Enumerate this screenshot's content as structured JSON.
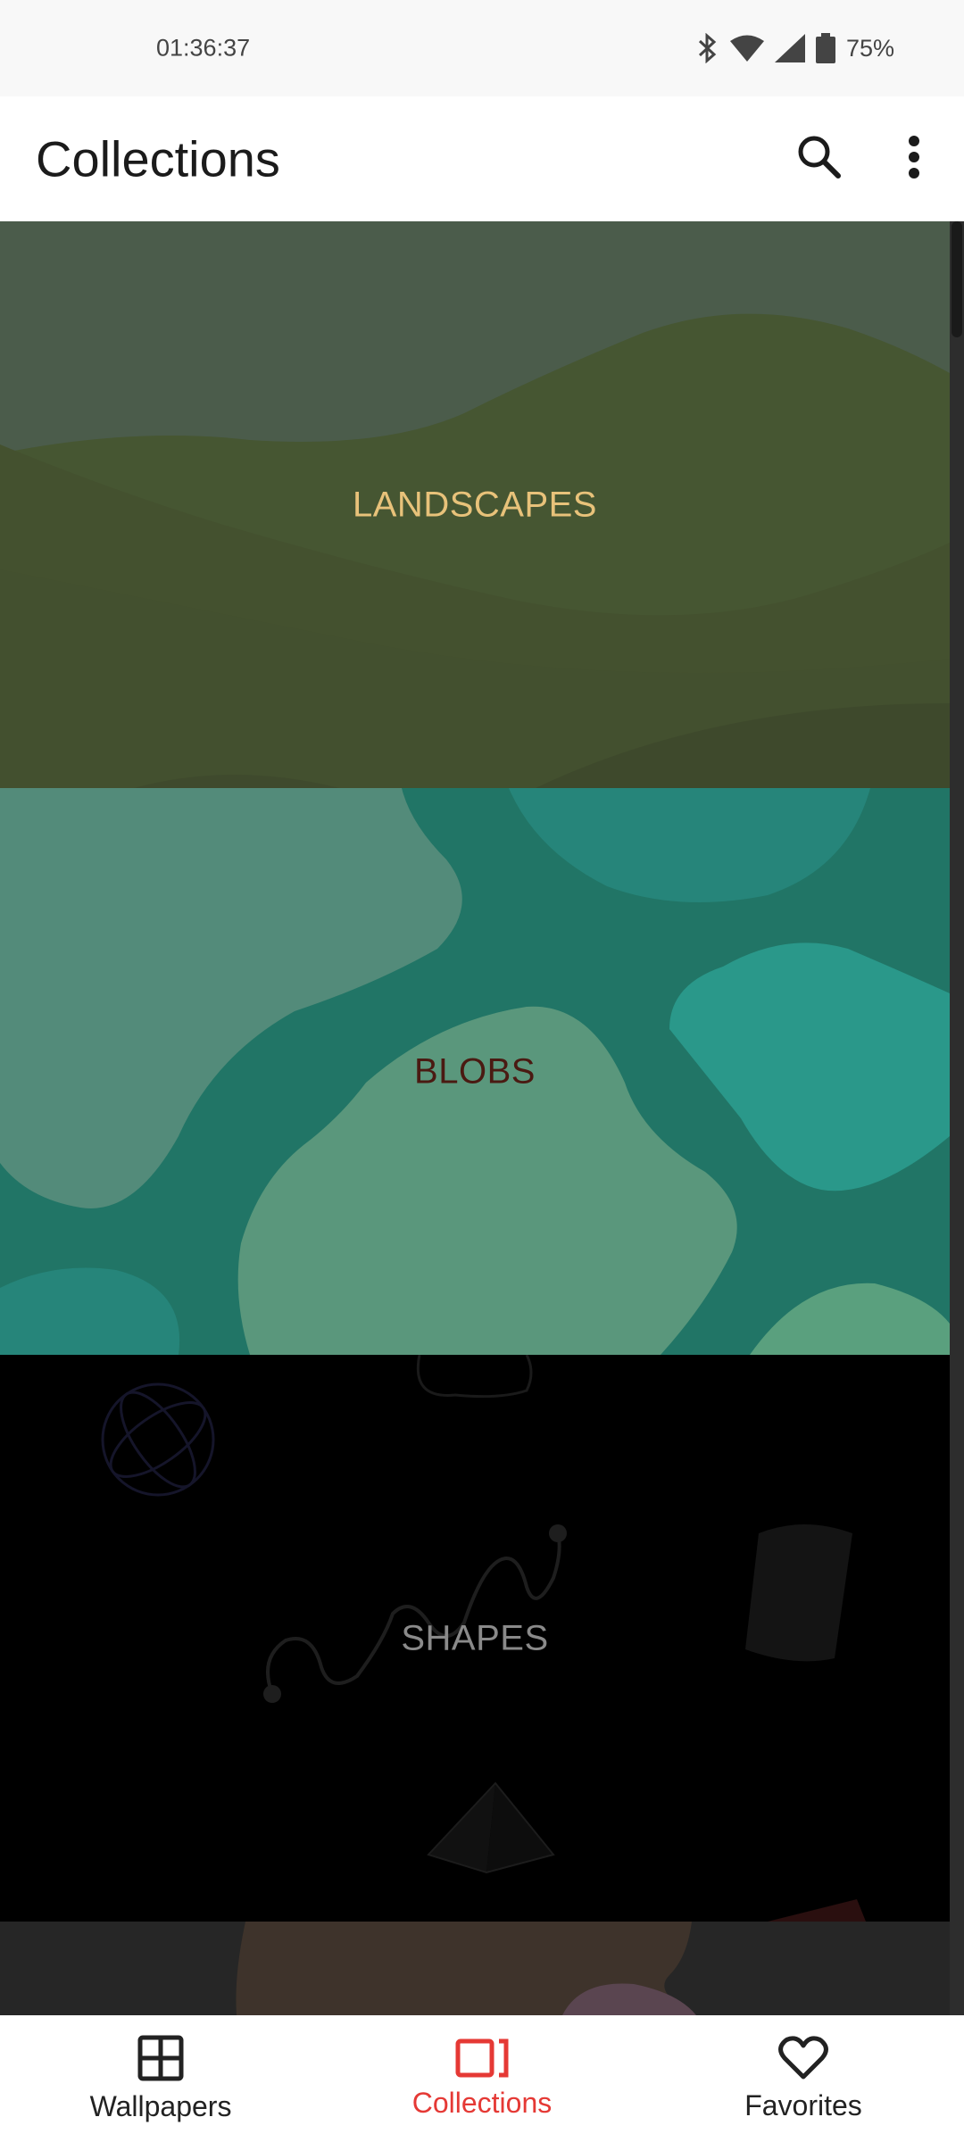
{
  "status_bar": {
    "time": "01:36:37",
    "battery": "75%"
  },
  "app_bar": {
    "title": "Collections"
  },
  "collections": [
    {
      "title": "LANDSCAPES",
      "title_color": "#e8c27a"
    },
    {
      "title": "BLOBS",
      "title_color": "#4a1a12"
    },
    {
      "title": "SHAPES",
      "title_color": "#8a8a8a"
    }
  ],
  "bottom_nav": {
    "items": [
      {
        "label": "Wallpapers",
        "icon": "grid-icon"
      },
      {
        "label": "Collections",
        "icon": "collections-icon",
        "active": true
      },
      {
        "label": "Favorites",
        "icon": "heart-icon"
      }
    ]
  },
  "colors": {
    "accent": "#e53935"
  }
}
